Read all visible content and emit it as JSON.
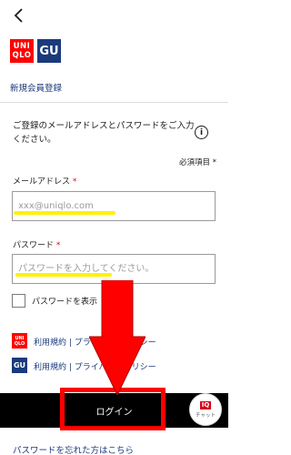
{
  "header": {
    "back_icon": "chevron-left-icon"
  },
  "brands": {
    "uniqlo_logo": [
      "UNI",
      "QLO"
    ],
    "gu_logo": "GU",
    "colors": {
      "uniqlo": "#ff0000",
      "gu": "#1a3a7c"
    }
  },
  "new_registration_link": "新規会員登録",
  "intro": "ご登録のメールアドレスとパスワードをご入力ください。",
  "info_icon": "info-icon",
  "required_note": "必須項目 *",
  "email": {
    "label": "メールアドレス",
    "required_mark": "*",
    "placeholder": "xxx@uniqlo.com",
    "value": ""
  },
  "password": {
    "label": "パスワード",
    "required_mark": "*",
    "placeholder": "パスワードを入力してください。",
    "value": ""
  },
  "show_password": {
    "label": "パスワードを表示",
    "checked": false
  },
  "terms": {
    "uniqlo": "利用規約 | プライバシーポリシー",
    "gu": "利用規約 | プライバシーポリシー"
  },
  "login_button": "ログイン",
  "chat_widget": {
    "badge": "IQ",
    "label": "チャット"
  },
  "forgot_password_link": "パスワードを忘れた方はこちら",
  "annotation": {
    "arrow_color": "#ff0000",
    "highlight_color": "#fff200"
  }
}
